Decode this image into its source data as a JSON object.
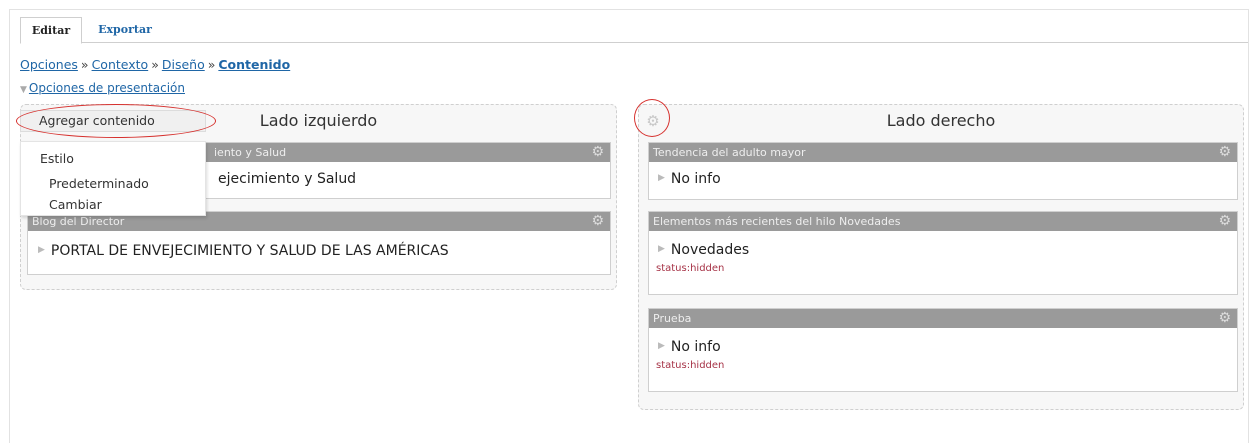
{
  "tabs": {
    "edit": "Editar",
    "export": "Exportar"
  },
  "breadcrumb": {
    "items": [
      "Opciones",
      "Contexto",
      "Diseño",
      "Contenido"
    ],
    "separator": "»"
  },
  "presentation_options": "Opciones de presentación",
  "left_region": {
    "title": "Lado izquierdo",
    "panes": [
      {
        "header": "iento y Salud",
        "content": "ejecimiento y Salud"
      },
      {
        "header": "Blog del Director",
        "content": "PORTAL DE ENVEJECIMIENTO Y SALUD DE LAS AMÉRICAS"
      }
    ]
  },
  "right_region": {
    "title": "Lado derecho",
    "panes": [
      {
        "header": "Tendencia del adulto mayor",
        "content": "No info",
        "status": ""
      },
      {
        "header": "Elementos más recientes del hilo Novedades",
        "content": "Novedades",
        "status": "status:hidden"
      },
      {
        "header": "Prueba",
        "content": "No info",
        "status": "status:hidden"
      }
    ]
  },
  "popup_menu": {
    "add_content": "Agregar contenido",
    "style_label": "Estilo",
    "style_current": "Predeterminado",
    "style_change": "Cambiar"
  },
  "colors": {
    "link": "#1f66a6",
    "pane_header": "#9a9a9a",
    "status": "#a63246",
    "highlight": "#d6312e"
  },
  "icons": [
    "gear-icon",
    "triangle-right-icon",
    "triangle-down-icon"
  ]
}
